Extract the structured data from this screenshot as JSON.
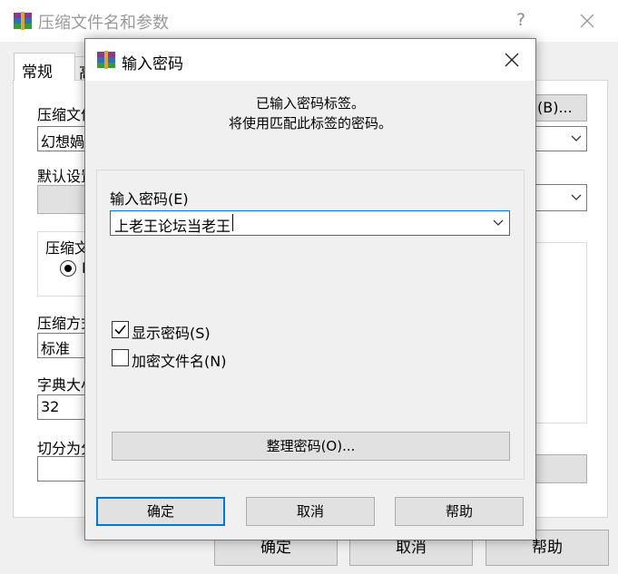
{
  "background_window": {
    "title": "压缩文件名和参数",
    "help_glyph": "?",
    "tabs": [
      "常规",
      "高"
    ],
    "archive_name_label": "压缩文件",
    "archive_name_value": "幻想媧",
    "browse_button": "(B)...",
    "default_settings_label": "默认设置",
    "format_group_label": "压缩文",
    "format_radio_letter": "R",
    "method_label": "压缩方式",
    "method_value": "标准",
    "dict_label": "字典大小",
    "dict_value": "32",
    "split_label": "切分为分卷",
    "buttons": {
      "ok": "确定",
      "cancel": "取消",
      "help": "帮助"
    }
  },
  "dialog": {
    "title": "输入密码",
    "info_line1": "已输入密码标签。",
    "info_line2": "将使用匹配此标签的密码。",
    "password_label": "输入密码(E)",
    "password_value": "上老王论坛当老王",
    "show_password": {
      "label": "显示密码(S)",
      "checked": true
    },
    "encrypt_names": {
      "label": "加密文件名(N)",
      "checked": false
    },
    "manage_button": "整理密码(O)...",
    "buttons": {
      "ok": "确定",
      "cancel": "取消",
      "help": "帮助"
    }
  },
  "colors": {
    "accent": "#0078d7",
    "button_face": "#e1e1e1",
    "window_bg": "#f0f0f0"
  }
}
